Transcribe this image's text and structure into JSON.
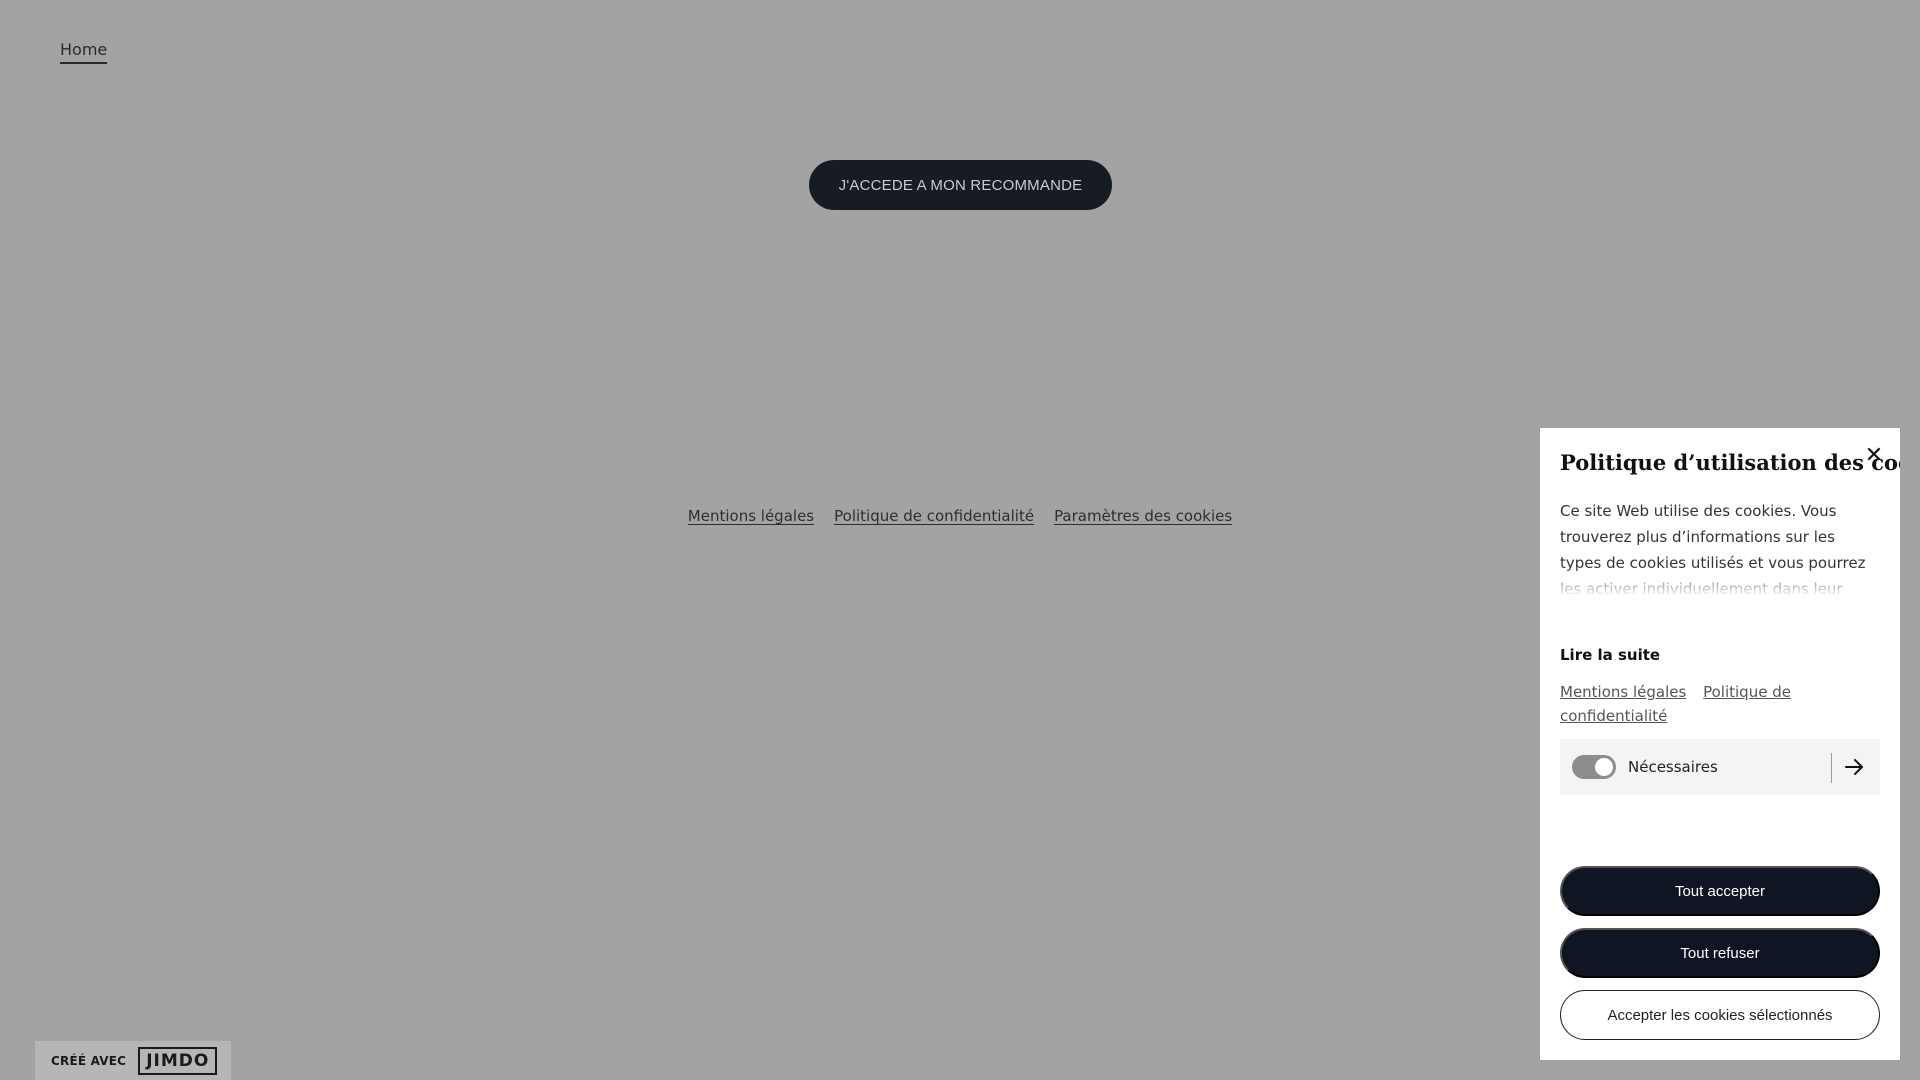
{
  "nav": {
    "home_label": "Home"
  },
  "main": {
    "cta_label": "J'ACCEDE A MON RECOMMANDE"
  },
  "footer": {
    "links": [
      "Mentions légales",
      "Politique de confidentialité",
      "Paramètres des cookies"
    ]
  },
  "badge": {
    "made_with": "CRÉÉ AVEC",
    "brand": "JIMDO"
  },
  "cookie_panel": {
    "title": "Politique d’utilisation des cookies",
    "description": "Ce site Web utilise des cookies. Vous trouverez plus d’informations sur les types de cookies utilisés et vous pourrez les activer individuellement dans leur catégorie respective. Vous pouvez ajuster",
    "read_more": "Lire la suite",
    "links": [
      "Mentions légales",
      "Politique de confidentialité"
    ],
    "category": {
      "label": "Nécessaires",
      "enabled": true
    },
    "buttons": {
      "accept_all": "Tout accepter",
      "reject_all": "Tout refuser",
      "accept_selected": "Accepter les cookies sélectionnés"
    }
  },
  "colors": {
    "overlay_bg": "#a3a3a3",
    "dark_button": "#0f1522",
    "panel_bg": "#ffffff"
  },
  "icons": {
    "close": "close-icon",
    "arrow": "arrow-right-icon",
    "toggle": "toggle-switch"
  }
}
